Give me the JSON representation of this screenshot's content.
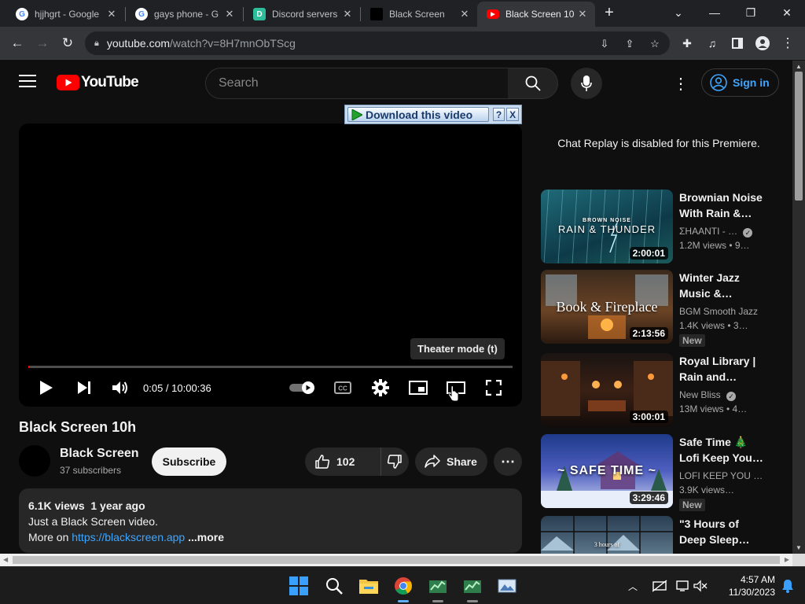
{
  "browser": {
    "tabs": [
      {
        "title": "hjjhgrt - Google",
        "favicon": "google-icon",
        "active": false
      },
      {
        "title": "gays phone - G",
        "favicon": "google-icon",
        "active": false
      },
      {
        "title": "Discord servers",
        "favicon": "discord-servers-icon",
        "active": false
      },
      {
        "title": "Black Screen",
        "favicon": "black-square-icon",
        "active": false
      },
      {
        "title": "Black Screen 10",
        "favicon": "youtube-icon",
        "active": true
      }
    ],
    "url_host": "youtube.com",
    "url_path": "/watch?v=8H7mnObTScg"
  },
  "youtube": {
    "logo_text": "YouTube",
    "search_placeholder": "Search",
    "signin_label": "Sign in"
  },
  "extension": {
    "download_label": "Download this video",
    "help_label": "?",
    "close_label": "X"
  },
  "player": {
    "time": "0:05 / 10:00:36",
    "progress": 8.3e-06,
    "tooltip": "Theater mode (t)"
  },
  "video": {
    "title": "Black Screen 10h",
    "channel": "Black Screen",
    "subscribers": "37 subscribers",
    "subscribe_label": "Subscribe",
    "likes": "102",
    "share_label": "Share",
    "description": {
      "stats": "6.1K views  1 year ago",
      "line1": "Just a Black Screen video.",
      "line2_prefix": "More on",
      "link": "https://blackscreen.app",
      "more": "...more"
    }
  },
  "sidebar": {
    "chat_replay": "Chat Replay is disabled for this Premiere.",
    "recommendations": [
      {
        "title": "Brownian Noise With Rain &…",
        "channel": "ΣHAANTI - …",
        "verified": true,
        "meta": "1.2M views  • 9…",
        "duration": "2:00:01",
        "thumb_text_small": "BROWN NOISE",
        "thumb_text": "RAIN & THUNDER",
        "badge": ""
      },
      {
        "title": "Winter Jazz Music &…",
        "channel": "BGM Smooth Jazz",
        "verified": false,
        "meta": "1.4K views  • 3…",
        "duration": "2:13:56",
        "thumb_text_small": "",
        "thumb_text": "Book & Fireplace",
        "badge": "New"
      },
      {
        "title": "Royal Library | Rain and…",
        "channel": "New Bliss",
        "verified": true,
        "meta": "13M views  • 4…",
        "duration": "3:00:01",
        "thumb_text_small": "",
        "thumb_text": "",
        "badge": ""
      },
      {
        "title": "Safe Time 🎄 Lofi Keep You…",
        "channel": "LOFI KEEP YOU …",
        "verified": false,
        "meta": "3.9K views…",
        "duration": "3:29:46",
        "thumb_text_small": "",
        "thumb_text": "~ SAFE TIME ~",
        "badge": "New"
      },
      {
        "title": "\"3 Hours of Deep Sleep…",
        "channel": "",
        "verified": false,
        "meta": "",
        "duration": "",
        "thumb_text_small": "3 hours of",
        "thumb_text": "",
        "badge": ""
      }
    ]
  },
  "taskbar": {
    "time": "4:57 AM",
    "date": "11/30/2023"
  },
  "colors": {
    "background": "#0f0f0f",
    "youtube_red": "#ff0000",
    "link_blue": "#3ea6ff"
  }
}
